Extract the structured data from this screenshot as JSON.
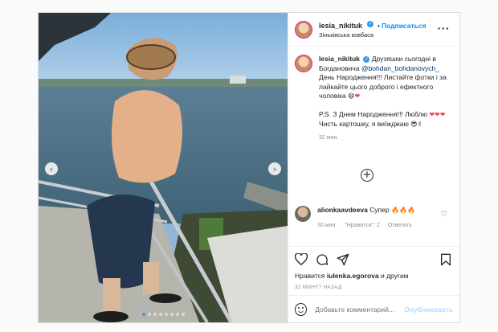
{
  "post": {
    "photo": {
      "description_icon": "photo-of-man-on-balcony",
      "carousel_dots": 8,
      "active_dot": 0
    },
    "header": {
      "username": "lesia_nikituk",
      "follow_label": "Подписаться",
      "location": "Зіньківська ковбаса"
    },
    "caption": {
      "username": "lesia_nikituk",
      "text_1": "Друзяшки сьогодні в Богдановича",
      "mention": "@bohdan_bohdanovych_",
      "text_2": "День Народження!!! Листайте фотки і за лайкайте цього доброго і ефектного чоловіка",
      "ps_1": "P.S. З Днем Народження!!! Люблю",
      "ps_2": "Чисть картошку, я виїжджаю",
      "time": "32 мин."
    },
    "comment": {
      "username": "alionkaavdeeva",
      "text": "Супер",
      "time": "30 мин.",
      "likes_label": "\"Нравится\": 2",
      "reply_label": "Ответить"
    },
    "likes": {
      "prefix": "Нравится",
      "user": "iulenka.egorova",
      "suffix": "и другим"
    },
    "timestamp": "32 МИНУТ НАЗАД",
    "add_comment": {
      "placeholder": "Добавьте комментарий...",
      "publish_label": "Опубликовать"
    }
  },
  "colors": {
    "accent": "#0095f6",
    "heart": "#ed4956",
    "muted": "#8e8e8e"
  }
}
